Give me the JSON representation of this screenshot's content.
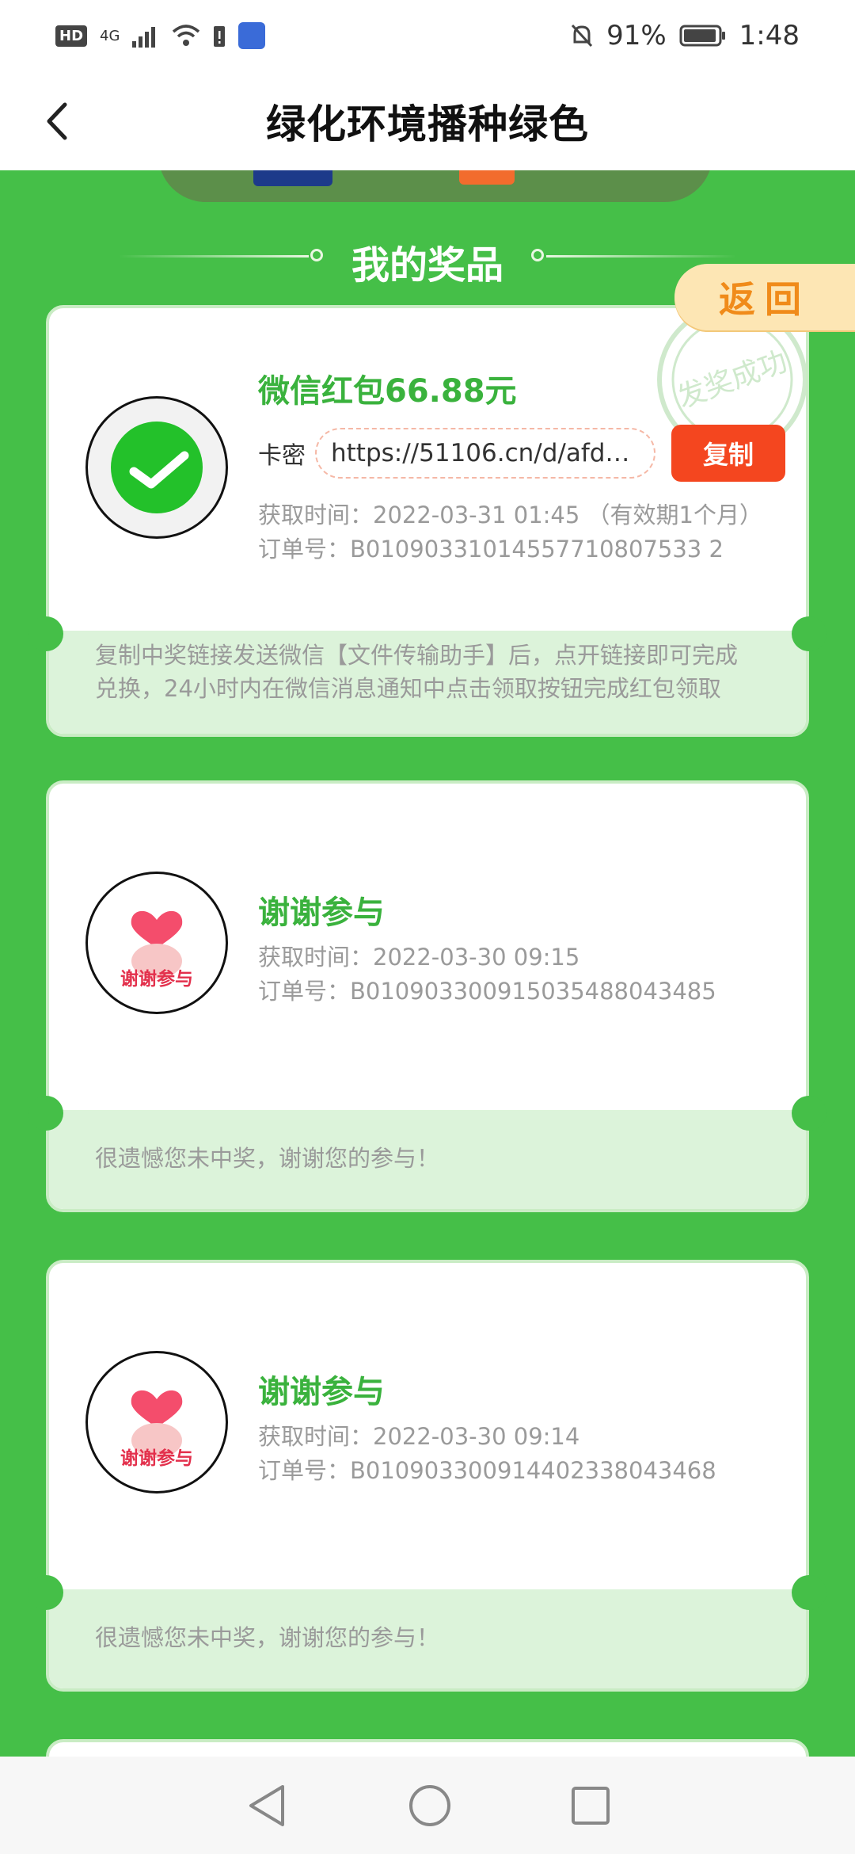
{
  "status_bar": {
    "network": "4G",
    "battery": "91%",
    "time": "1:48"
  },
  "header": {
    "title": "绿化环境播种绿色"
  },
  "section": {
    "title": "我的奖品",
    "return_label": "返回"
  },
  "prizes": [
    {
      "name": "微信红包66.88元",
      "code_label": "卡密",
      "code": "https://51106.cn/d/afd…",
      "copy_label": "复制",
      "time": "获取时间：2022-03-31 01:45 （有效期1个月）",
      "order": "订单号：B01090331014557710807533 2",
      "stamp_text": "发奖成功",
      "note": "复制中奖链接发送微信【文件传输助手】后，点开链接即可完成兑换，24小时内在微信消息通知中点击领取按钮完成红包领取"
    },
    {
      "name": "谢谢参与",
      "logo_text": "谢谢参与",
      "time": "获取时间：2022-03-30 09:15",
      "order": "订单号：B010903300915035488043485",
      "note": "很遗憾您未中奖，谢谢您的参与！"
    },
    {
      "name": "谢谢参与",
      "logo_text": "谢谢参与",
      "time": "获取时间：2022-03-30 09:14",
      "order": "订单号：B010903300914402338043468",
      "note": "很遗憾您未中奖，谢谢您的参与！"
    }
  ],
  "colors": {
    "brand_green": "#45bf48",
    "prize_green": "#3ab23d",
    "copy_red": "#f4461f",
    "return_orange": "#f08b1a"
  },
  "icons": [
    "back-arrow-icon",
    "wechat-icon",
    "heart-hand-icon",
    "nav-back-icon",
    "nav-home-icon",
    "nav-recents-icon"
  ]
}
